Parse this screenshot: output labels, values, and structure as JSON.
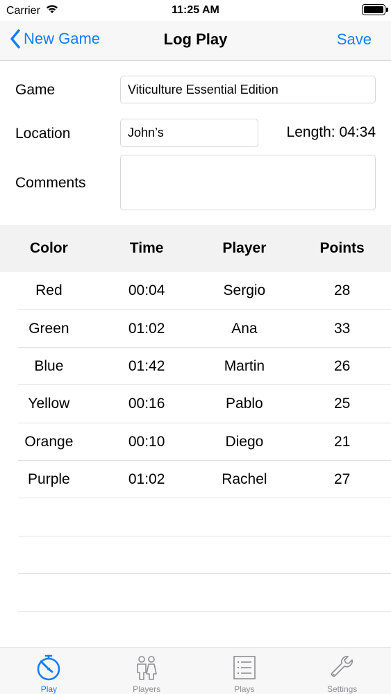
{
  "status_bar": {
    "carrier": "Carrier",
    "time": "11:25 AM"
  },
  "nav": {
    "back_label": "New Game",
    "title": "Log Play",
    "save_label": "Save"
  },
  "form": {
    "game_label": "Game",
    "game_value": "Viticulture Essential Edition",
    "location_label": "Location",
    "location_value": "John’s",
    "length_text": "Length: 04:34",
    "comments_label": "Comments",
    "comments_value": ""
  },
  "table": {
    "headers": [
      "Color",
      "Time",
      "Player",
      "Points"
    ],
    "rows": [
      [
        "Red",
        "00:04",
        "Sergio",
        "28"
      ],
      [
        "Green",
        "01:02",
        "Ana",
        "33"
      ],
      [
        "Blue",
        "01:42",
        "Martin",
        "26"
      ],
      [
        "Yellow",
        "00:16",
        "Pablo",
        "25"
      ],
      [
        "Orange",
        "00:10",
        "Diego",
        "21"
      ],
      [
        "Purple",
        "01:02",
        "Rachel",
        "27"
      ]
    ]
  },
  "tabs": [
    {
      "label": "Play",
      "icon": "stopwatch-icon",
      "active": true
    },
    {
      "label": "Players",
      "icon": "people-icon",
      "active": false
    },
    {
      "label": "Plays",
      "icon": "list-icon",
      "active": false
    },
    {
      "label": "Settings",
      "icon": "wrench-icon",
      "active": false
    }
  ],
  "colors": {
    "accent": "#147efb",
    "inactive": "#8e8e93"
  }
}
